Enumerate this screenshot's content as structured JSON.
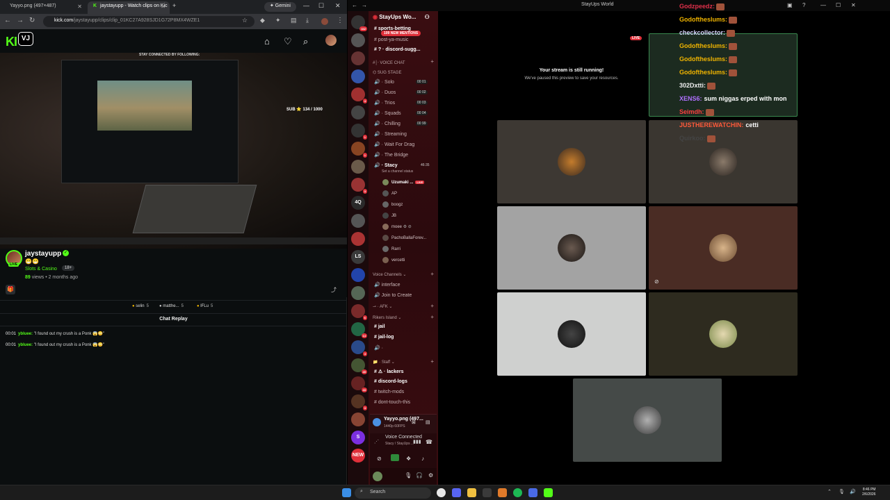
{
  "browser": {
    "tabs": [
      {
        "label": "Yayyo.png (497×487)"
      },
      {
        "label": "jaystayupp - Watch clips on Kic"
      }
    ],
    "gemini_label": "✦ Gemini",
    "url_host": "kick.com",
    "url_path": "/jaystayupp/clips/clip_01KC27A928SJD1G72P8MX4WZE1"
  },
  "kick": {
    "logo": "KI",
    "badge": "VJ",
    "channel_name": "jaystayupp",
    "emotes": "😁😁",
    "category": "Slots & Casino",
    "age_tag": "18+",
    "views_count": "89",
    "views_suffix": "views • 2 months ago",
    "live_label": "LIVE",
    "gifters": [
      {
        "name": "selin",
        "count": "5"
      },
      {
        "name": "matthe...",
        "count": "5"
      },
      {
        "name": "lFLu",
        "count": "5"
      }
    ],
    "chat_replay_title": "Chat Replay",
    "chat": [
      {
        "time": "00:01",
        "user": "ybluee:",
        "text": "\"I found out my crush is a Ponk 😱😳\""
      },
      {
        "time": "00:01",
        "user": "ybluee:",
        "text": "\"I found out my crush is a Ponk 😱😳\""
      }
    ],
    "video": {
      "stay_text": "STAY CONNECTED BY FOLLOWING:",
      "goal_label": "SUB",
      "goal_value": "134 / 1000"
    }
  },
  "discord": {
    "window_title": "StayUps World",
    "server_name": "StayUps Wo...",
    "mentions_label": "109 NEW MENTIONS",
    "channels_top": [
      {
        "label": "sports-betting"
      },
      {
        "label": "post-ya-music"
      },
      {
        "label": "discord-sugg..."
      }
    ],
    "voice_chat_category": "VOICE CHAT",
    "sug_stage": "SUG STAGE",
    "voice_channels": [
      {
        "label": "Solo",
        "count": "00  01"
      },
      {
        "label": "Duos",
        "count": "00  02"
      },
      {
        "label": "Trios",
        "count": "00  03"
      },
      {
        "label": "Squads",
        "count": "00  04"
      },
      {
        "label": "Chilling",
        "count": "00  99"
      },
      {
        "label": "Streaming",
        "count": ""
      },
      {
        "label": "Wait For Drag",
        "count": ""
      },
      {
        "label": "The Bridge",
        "count": ""
      }
    ],
    "stacy": {
      "label": "Stacy",
      "timer": "46:35",
      "status": "Set a channel status"
    },
    "vc_users": [
      {
        "name": "Uzumaki ...",
        "live": "LIVE"
      },
      {
        "name": "AP",
        "live": ""
      },
      {
        "name": "boogz",
        "live": ""
      },
      {
        "name": "JB",
        "live": ""
      },
      {
        "name": "moee",
        "live": ""
      },
      {
        "name": "PachoBallaForev...",
        "live": ""
      },
      {
        "name": "Rarri",
        "live": ""
      },
      {
        "name": "vercetti",
        "live": ""
      }
    ],
    "voice_channels_cat": "Voice Channels",
    "vc2": [
      {
        "label": "interface"
      },
      {
        "label": "Join to Create"
      }
    ],
    "afk_cat": "AFK",
    "rikers_cat": "Rikers Island",
    "rikers": [
      {
        "label": "jail"
      },
      {
        "label": "jail-log"
      }
    ],
    "staff_cat": "Staff",
    "staff": [
      {
        "label": "lackers"
      },
      {
        "label": "discord-logs"
      },
      {
        "label": "twitch-mods"
      },
      {
        "label": "dont-touch-this"
      }
    ],
    "streaming_card": {
      "title": "Yayyo.png (497...",
      "sub": "1440p 60FPS"
    },
    "voice_connected": {
      "title": "Voice Connected",
      "sub": "Stacy / StayUps ..."
    },
    "servers": [
      {
        "label": "",
        "badge": "442"
      },
      {
        "label": "",
        "badge": ""
      },
      {
        "label": "",
        "badge": ""
      },
      {
        "label": "",
        "badge": ""
      },
      {
        "label": "",
        "badge": "4"
      },
      {
        "label": "",
        "badge": ""
      },
      {
        "label": "",
        "badge": "1"
      },
      {
        "label": "",
        "badge": "1"
      },
      {
        "label": "",
        "badge": ""
      },
      {
        "label": "",
        "badge": "3"
      },
      {
        "label": "4Q",
        "badge": ""
      },
      {
        "label": "",
        "badge": ""
      },
      {
        "label": "",
        "badge": ""
      },
      {
        "label": "LS",
        "badge": ""
      },
      {
        "label": "",
        "badge": ""
      },
      {
        "label": "",
        "badge": ""
      },
      {
        "label": "",
        "badge": "6"
      },
      {
        "label": "",
        "badge": "14"
      },
      {
        "label": "",
        "badge": "4"
      },
      {
        "label": "",
        "badge": "49"
      },
      {
        "label": "",
        "badge": "43"
      },
      {
        "label": "",
        "badge": "3"
      },
      {
        "label": "",
        "badge": ""
      },
      {
        "label": "S",
        "badge": ""
      },
      {
        "label": "NEW",
        "badge": ""
      }
    ],
    "stage": {
      "live_label": "LIVE",
      "msg_title": "Your stream is still running!",
      "msg_sub": "We've paused this preview to save your resources."
    },
    "overlay_chat": [
      {
        "user": "Godzpeedz:",
        "color": "#e0304a",
        "msg": ""
      },
      {
        "user": "Godoftheslums:",
        "color": "#f0b400",
        "msg": ""
      },
      {
        "user": "checkcollector:",
        "color": "#d8d8ff",
        "msg": ""
      },
      {
        "user": "Godoftheslums:",
        "color": "#f0b400",
        "msg": ""
      },
      {
        "user": "Godoftheslums:",
        "color": "#f0b400",
        "msg": ""
      },
      {
        "user": "Godoftheslums:",
        "color": "#f0b400",
        "msg": ""
      },
      {
        "user": "302Dxtti:",
        "color": "#f0f0f0",
        "msg": ""
      },
      {
        "user": "XENS6:",
        "color": "#b070ff",
        "msg": "sum niggas erped with mon"
      },
      {
        "user": "Seimdh:",
        "color": "#ff4040",
        "msg": ""
      },
      {
        "user": "JUSTHEREWATCHIN:",
        "color": "#ff5a3a",
        "msg": "cetti"
      },
      {
        "user": "Quirkoo:",
        "color": "#444",
        "msg": ""
      }
    ]
  },
  "taskbar": {
    "search_label": "Search",
    "time": "8:46 PM",
    "date": "2/6/2026"
  }
}
